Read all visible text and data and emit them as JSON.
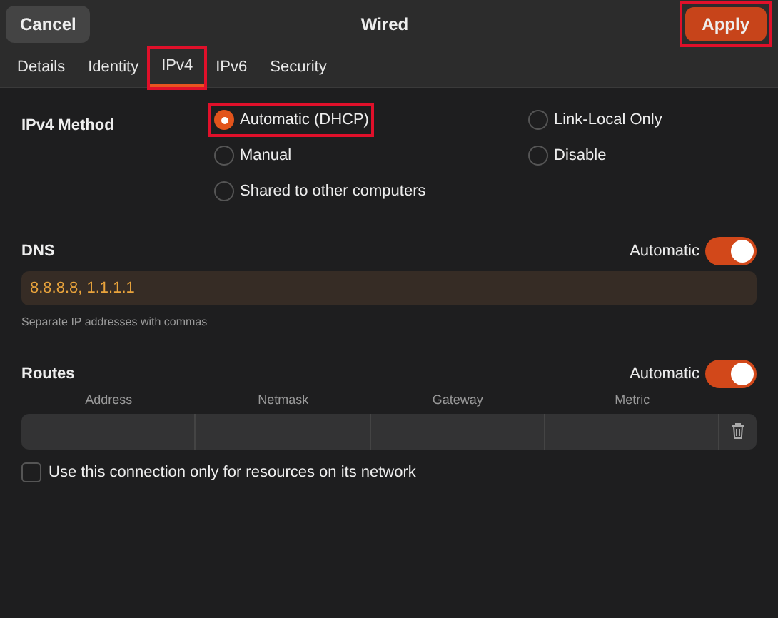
{
  "header": {
    "title": "Wired",
    "cancel": {
      "label": "Cancel"
    },
    "apply": {
      "label": "Apply",
      "highlighted": true
    }
  },
  "tabs": [
    {
      "label": "Details",
      "selected": false,
      "highlighted": false
    },
    {
      "label": "Identity",
      "selected": false,
      "highlighted": false
    },
    {
      "label": "IPv4",
      "selected": true,
      "highlighted": true
    },
    {
      "label": "IPv6",
      "selected": false,
      "highlighted": false
    },
    {
      "label": "Security",
      "selected": false,
      "highlighted": false
    }
  ],
  "method": {
    "label": "IPv4 Method",
    "options": [
      {
        "label": "Automatic (DHCP)",
        "selected": true,
        "highlighted": true
      },
      {
        "label": "Link-Local Only",
        "selected": false,
        "highlighted": false
      },
      {
        "label": "Manual",
        "selected": false,
        "highlighted": false
      },
      {
        "label": "Disable",
        "selected": false,
        "highlighted": false
      },
      {
        "label": "Shared to other computers",
        "selected": false,
        "highlighted": false
      }
    ]
  },
  "dns": {
    "label": "DNS",
    "automatic_label": "Automatic",
    "automatic_on": true,
    "value": "8.8.8.8, 1.1.1.1",
    "hint": "Separate IP addresses with commas"
  },
  "routes": {
    "label": "Routes",
    "automatic_label": "Automatic",
    "automatic_on": true,
    "columns": [
      "Address",
      "Netmask",
      "Gateway",
      "Metric"
    ]
  },
  "only_local": {
    "label": "Use this connection only for resources on its network",
    "checked": false
  }
}
